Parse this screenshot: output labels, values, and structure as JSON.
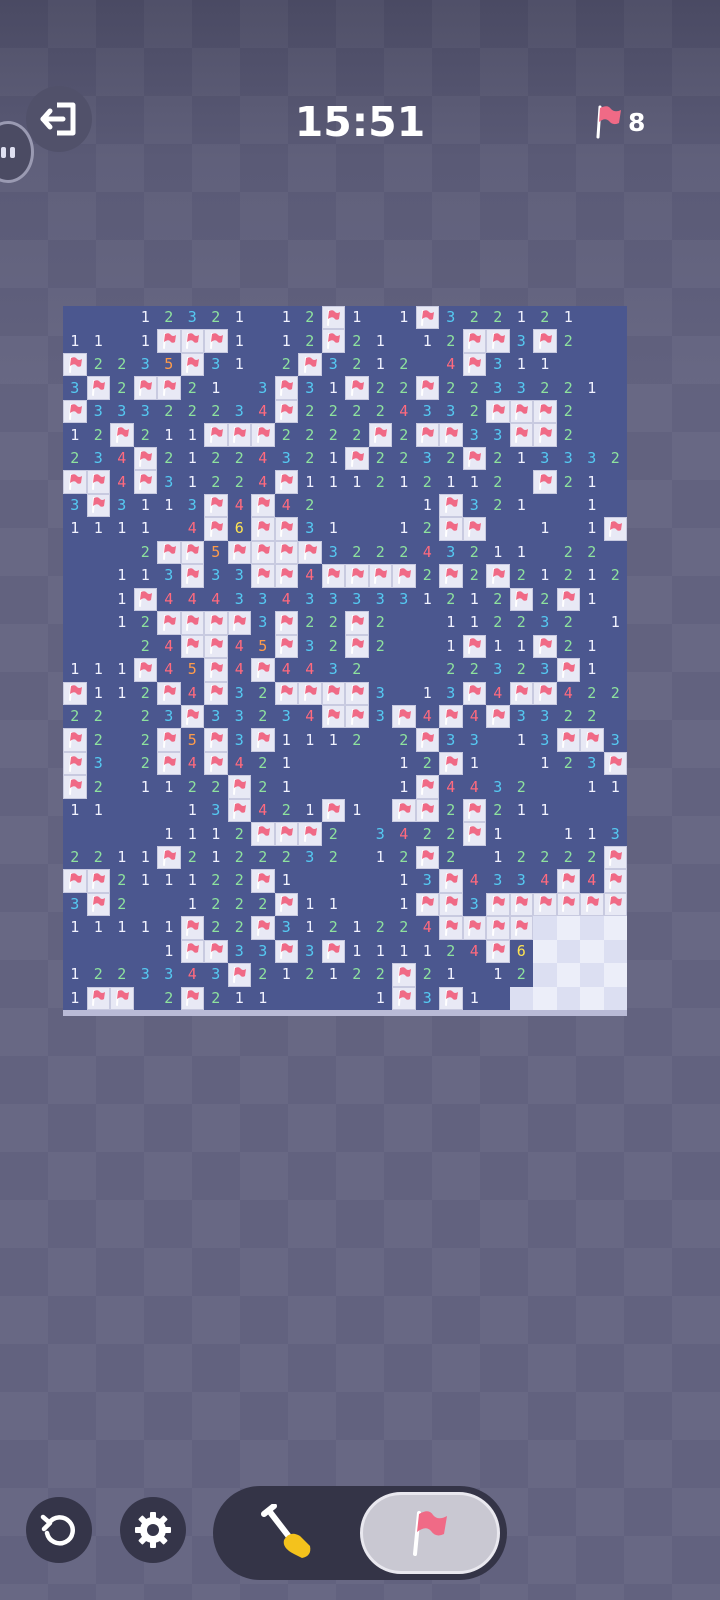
{
  "header": {
    "timer": "15:51",
    "flags_remaining": "8",
    "exit_icon": "exit-door-icon",
    "flag_icon": "flag-icon"
  },
  "colors": {
    "board_open": "#4b578f",
    "flagged_cell": "#e8e9f5",
    "flag_red": "#f06a86",
    "n1": "#f1f2ff",
    "n2": "#8ee29e",
    "n3": "#55c9f2",
    "n4": "#ff6a7e",
    "n5": "#ff9c4a",
    "n6": "#ffe451"
  },
  "board": {
    "cols": 24,
    "rows": 30,
    "grid": [
      "...12321.12F1.1F322121..",
      "11.1FFF1.12F21.12FF3F2..",
      "F2235F31.2F3212.4F311...",
      "3F2FF21.3F31F22F2233221.",
      "F33322234F22224332FFF2..",
      "12F211FFF2222F2FF33FF2..",
      "234F21224321F2232F213332",
      "FF4F31224F111212112.F21.",
      "3F3113F4F42....1F321..1.",
      "1111.4F6FF31..12FF..1.1F",
      "...2FF5FFFF322243211.22.",
      "..113F33FF4FFFF2F2F21212",
      "..1F444334333331212F2F1.",
      "..12FFFF3F22F2..112232.1",
      "...24FF45F32F2..1F11F21.",
      "111F45F4F4432...22323F1.",
      "F112F4F32FFFF3.13F4FF422",
      "22.23F33234FF3F4F4F3322.",
      "F2.2F5F3F1112.2F33.13FF3",
      "F3.2F4F421....12F1..123F",
      "F2.1122F21....1F4432..11",
      "11...13F421F1.FF2F211...",
      "....1112FFF2.3422F1..113",
      "2211F2122232.12F2.12222F",
      "FF211122F1....13F4334F4F",
      "3F2..1222F11..1FF3FFFFFF",
      "11111F22F3121224FFFF....",
      "....1FF33F3F111124F6....",
      "1223343F212122F21.12....",
      "1FF.2F211....1F3F1...1.."
    ]
  }
}
